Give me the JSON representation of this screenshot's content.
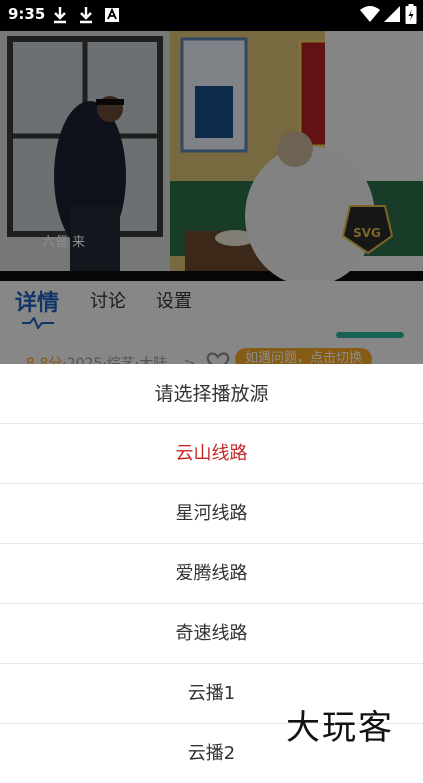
{
  "status_bar": {
    "time": "9:35",
    "icons": [
      "download-icon",
      "download-icon",
      "text-a-icon",
      "wifi-icon",
      "signal-icon",
      "battery-icon"
    ]
  },
  "video": {
    "caption": "六督 来",
    "badge_text": "SVG"
  },
  "tabs": [
    {
      "label": "详情",
      "active": true
    },
    {
      "label": "讨论",
      "active": false
    },
    {
      "label": "设置",
      "active": false
    }
  ],
  "info": {
    "score": "8.8分",
    "meta": "·2025·综艺·大陆",
    "chevron": ">",
    "hint": "如遇问题，点击切换"
  },
  "sheet": {
    "title": "请选择播放源",
    "options": [
      "云山线路",
      "星河线路",
      "爱腾线路",
      "奇速线路",
      "云播1",
      "云播2"
    ],
    "selected_index": 0
  },
  "watermark": "大玩客",
  "colors": {
    "accent_blue": "#1f5fbf",
    "selected_red": "#c62828",
    "badge_orange": "#f5a623"
  }
}
